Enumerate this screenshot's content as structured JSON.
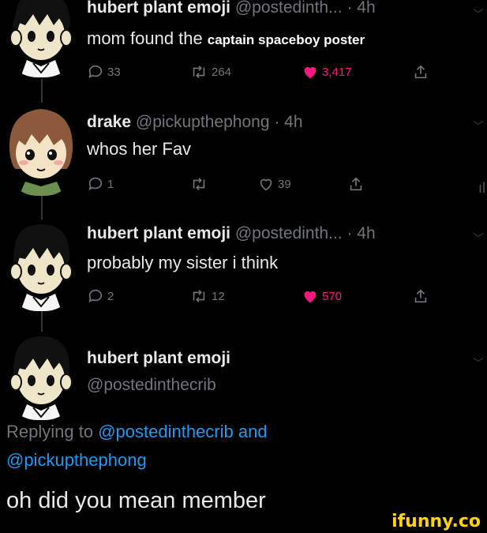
{
  "tweets": [
    {
      "name": "hubert plant emoji",
      "handle": "@postedinth...",
      "time": "· 4h",
      "text": "mom found the",
      "overlay": "captain spaceboy poster",
      "replies": "33",
      "retweets": "264",
      "likes": "3,417",
      "liked": true
    },
    {
      "name": "drake",
      "handle": "@pickupthephong",
      "time": "· 4h",
      "text": "whos her Fav",
      "replies": "1",
      "retweets": "",
      "likes": "39",
      "liked": false
    },
    {
      "name": "hubert plant emoji",
      "handle": "@postedinth...",
      "time": "· 4h",
      "text": "probably my sister i think",
      "replies": "2",
      "retweets": "12",
      "likes": "570",
      "liked": true
    }
  ],
  "focused": {
    "name": "hubert plant emoji",
    "handle": "@postedinthecrib",
    "replying_prefix": "Replying to",
    "mention1": "@postedinthecrib",
    "and": "and",
    "mention2": "@pickupthephong",
    "text": "oh did you mean member"
  },
  "watermark": "ifunny.co",
  "colors": {
    "background": "#000000",
    "text": "#e7e9ea",
    "muted": "#71767b",
    "link": "#1d9bf0",
    "like": "#f91880",
    "watermark": "#ffd400"
  }
}
